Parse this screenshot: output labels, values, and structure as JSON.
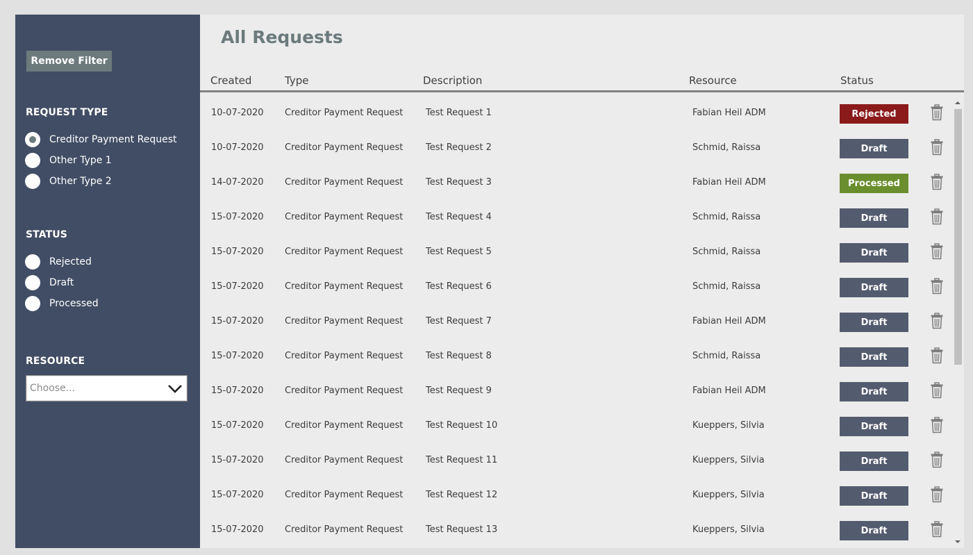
{
  "sidebar": {
    "remove_filter_label": "Remove Filter",
    "request_type": {
      "heading": "REQUEST TYPE",
      "options": [
        {
          "label": "Creditor Payment Request",
          "selected": true
        },
        {
          "label": "Other Type 1",
          "selected": false
        },
        {
          "label": "Other Type 2",
          "selected": false
        }
      ]
    },
    "status": {
      "heading": "STATUS",
      "options": [
        {
          "label": "Rejected",
          "selected": false
        },
        {
          "label": "Draft",
          "selected": false
        },
        {
          "label": "Processed",
          "selected": false
        }
      ]
    },
    "resource": {
      "heading": "RESOURCE",
      "placeholder": "Choose..."
    }
  },
  "main": {
    "title": "All Requests",
    "columns": [
      "Created",
      "Type",
      "Description",
      "Resource",
      "Status"
    ],
    "rows": [
      {
        "created": "10-07-2020",
        "type": "Creditor Payment Request",
        "description": "Test Request 1",
        "resource": "Fabian Heil ADM",
        "status": "Rejected"
      },
      {
        "created": "10-07-2020",
        "type": "Creditor Payment Request",
        "description": "Test Request 2",
        "resource": "Schmid, Raissa",
        "status": "Draft"
      },
      {
        "created": "14-07-2020",
        "type": "Creditor Payment Request",
        "description": "Test Request 3",
        "resource": "Fabian Heil ADM",
        "status": "Processed"
      },
      {
        "created": "15-07-2020",
        "type": "Creditor Payment Request",
        "description": "Test Request 4",
        "resource": "Schmid, Raissa",
        "status": "Draft"
      },
      {
        "created": "15-07-2020",
        "type": "Creditor Payment Request",
        "description": "Test Request 5",
        "resource": "Schmid, Raissa",
        "status": "Draft"
      },
      {
        "created": "15-07-2020",
        "type": "Creditor Payment Request",
        "description": "Test Request 6",
        "resource": "Schmid, Raissa",
        "status": "Draft"
      },
      {
        "created": "15-07-2020",
        "type": "Creditor Payment Request",
        "description": "Test Request 7",
        "resource": "Fabian Heil ADM",
        "status": "Draft"
      },
      {
        "created": "15-07-2020",
        "type": "Creditor Payment Request",
        "description": "Test Request 8",
        "resource": "Schmid, Raissa",
        "status": "Draft"
      },
      {
        "created": "15-07-2020",
        "type": "Creditor Payment Request",
        "description": "Test Request 9",
        "resource": "Fabian Heil ADM",
        "status": "Draft"
      },
      {
        "created": "15-07-2020",
        "type": "Creditor Payment Request",
        "description": "Test Request 10",
        "resource": "Kueppers, Silvia",
        "status": "Draft"
      },
      {
        "created": "15-07-2020",
        "type": "Creditor Payment Request",
        "description": "Test Request 11",
        "resource": "Kueppers, Silvia",
        "status": "Draft"
      },
      {
        "created": "15-07-2020",
        "type": "Creditor Payment Request",
        "description": "Test Request 12",
        "resource": "Kueppers, Silvia",
        "status": "Draft"
      },
      {
        "created": "15-07-2020",
        "type": "Creditor Payment Request",
        "description": "Test Request 13",
        "resource": "Kueppers, Silvia",
        "status": "Draft"
      }
    ],
    "row_icon": "trash-icon"
  },
  "colors": {
    "sidebar_bg": "#414d65",
    "main_bg": "#ececec",
    "accent_gray": "#6c7a7c",
    "status_rejected": "#8b1a1a",
    "status_draft": "#535b6e",
    "status_processed": "#6a8e2e"
  },
  "scroll": {
    "position_fraction": 0.0,
    "visible_fraction": 0.6
  }
}
